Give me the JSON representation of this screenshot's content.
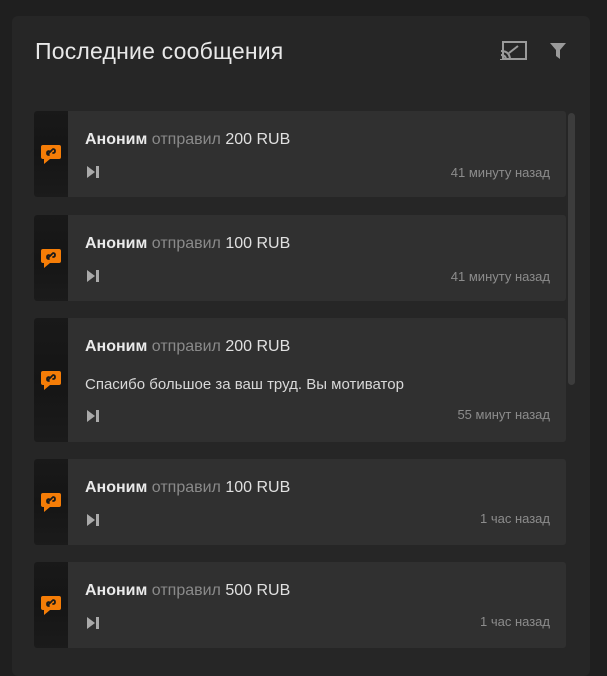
{
  "header": {
    "title": "Последние сообщения",
    "cast_icon": "cast-icon",
    "filter_icon": "filter-icon"
  },
  "messages": [
    {
      "name": "Аноним",
      "verb": "отправил",
      "amount": "200 RUB",
      "text": "",
      "time": "41 минуту назад"
    },
    {
      "name": "Аноним",
      "verb": "отправил",
      "amount": "100 RUB",
      "text": "",
      "time": "41 минуту назад"
    },
    {
      "name": "Аноним",
      "verb": "отправил",
      "amount": "200 RUB",
      "text": "Спасибо большое за ваш труд. Вы мотиватор",
      "time": "55 минут назад"
    },
    {
      "name": "Аноним",
      "verb": "отправил",
      "amount": "100 RUB",
      "text": "",
      "time": "1 час назад"
    },
    {
      "name": "Аноним",
      "verb": "отправил",
      "amount": "500 RUB",
      "text": "",
      "time": "1 час назад"
    }
  ],
  "colors": {
    "accent": "#f57d07",
    "background": "#1f1f1f",
    "panel": "#262626",
    "card": "#303030"
  },
  "icons": {
    "brand": "donationalerts-icon",
    "play": "play-skip-icon"
  }
}
